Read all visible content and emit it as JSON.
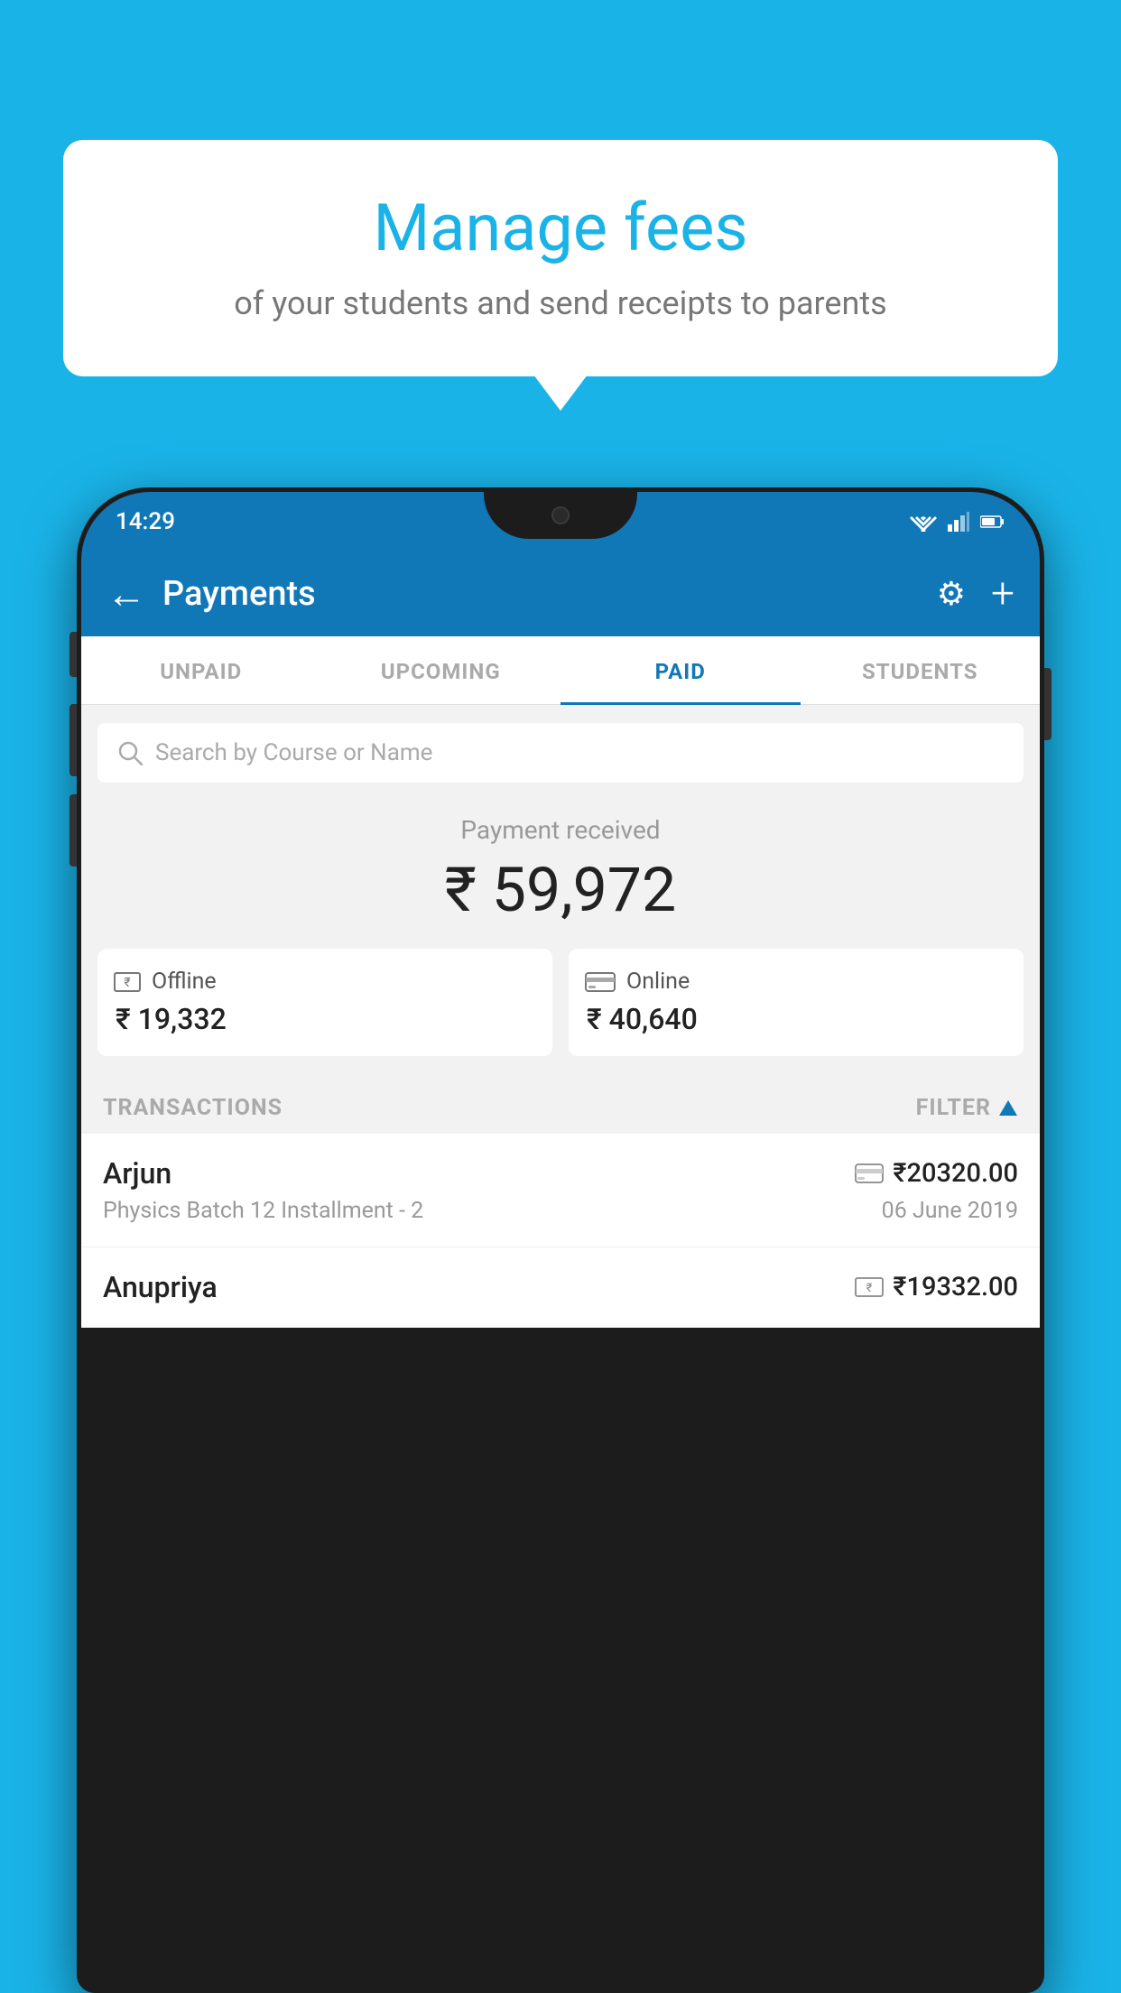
{
  "background_color": "#1ab3e8",
  "bubble": {
    "title": "Manage fees",
    "subtitle": "of your students and send receipts to parents"
  },
  "status_bar": {
    "time": "14:29",
    "wifi_icon": "▾",
    "signal_icon": "▲",
    "battery_icon": "▮"
  },
  "header": {
    "title": "Payments",
    "back_label": "←",
    "settings_icon": "⚙",
    "add_icon": "+"
  },
  "tabs": [
    {
      "label": "UNPAID",
      "active": false
    },
    {
      "label": "UPCOMING",
      "active": false
    },
    {
      "label": "PAID",
      "active": true
    },
    {
      "label": "STUDENTS",
      "active": false
    }
  ],
  "search": {
    "placeholder": "Search by Course or Name"
  },
  "payment_received": {
    "label": "Payment received",
    "amount": "₹ 59,972"
  },
  "payment_cards": [
    {
      "icon": "offline",
      "label": "Offline",
      "amount": "₹ 19,332"
    },
    {
      "icon": "online",
      "label": "Online",
      "amount": "₹ 40,640"
    }
  ],
  "transactions_section": {
    "label": "TRANSACTIONS",
    "filter_label": "FILTER"
  },
  "transactions": [
    {
      "name": "Arjun",
      "detail": "Physics Batch 12 Installment - 2",
      "amount": "₹20320.00",
      "date": "06 June 2019",
      "icon": "card"
    },
    {
      "name": "Anupriya",
      "detail": "",
      "amount": "₹19332.00",
      "date": "",
      "icon": "cash"
    }
  ]
}
